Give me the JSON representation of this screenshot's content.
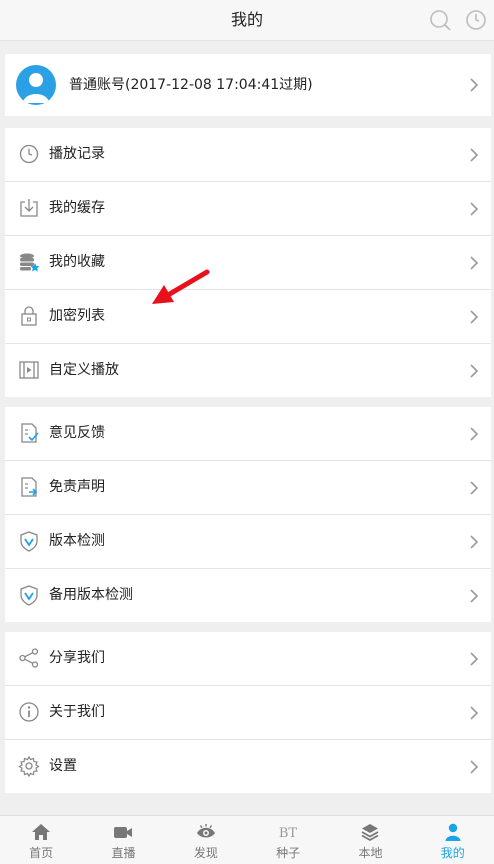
{
  "header": {
    "title": "我的"
  },
  "profile": {
    "account_text": "普通账号(2017-12-08 17:04:41过期)"
  },
  "groups": [
    {
      "items": [
        {
          "name": "play-history",
          "label": "播放记录",
          "icon": "clock-icon"
        },
        {
          "name": "my-cache",
          "label": "我的缓存",
          "icon": "download-icon"
        },
        {
          "name": "my-favorites",
          "label": "我的收藏",
          "icon": "database-star-icon"
        },
        {
          "name": "encrypted-list",
          "label": "加密列表",
          "icon": "lock-icon"
        },
        {
          "name": "custom-play",
          "label": "自定义播放",
          "icon": "film-play-icon"
        }
      ]
    },
    {
      "items": [
        {
          "name": "feedback",
          "label": "意见反馈",
          "icon": "document-check-icon"
        },
        {
          "name": "disclaimer",
          "label": "免责声明",
          "icon": "document-share-icon"
        },
        {
          "name": "version-check",
          "label": "版本检测",
          "icon": "shield-v-icon"
        },
        {
          "name": "backup-version-check",
          "label": "备用版本检测",
          "icon": "shield-v-icon"
        }
      ]
    },
    {
      "items": [
        {
          "name": "share-us",
          "label": "分享我们",
          "icon": "share-icon"
        },
        {
          "name": "about-us",
          "label": "关于我们",
          "icon": "info-icon"
        },
        {
          "name": "settings",
          "label": "设置",
          "icon": "gear-icon"
        }
      ]
    }
  ],
  "tabbar": {
    "active": "mine",
    "tabs": [
      {
        "name": "home",
        "label": "首页",
        "icon": "home-icon"
      },
      {
        "name": "live",
        "label": "直播",
        "icon": "video-camera-icon"
      },
      {
        "name": "discover",
        "label": "发现",
        "icon": "eye-icon"
      },
      {
        "name": "bt-seeds",
        "label": "种子",
        "icon": "bt-icon",
        "icon_text": "BT"
      },
      {
        "name": "local",
        "label": "本地",
        "icon": "layers-icon"
      },
      {
        "name": "mine",
        "label": "我的",
        "icon": "user-icon"
      }
    ]
  },
  "colors": {
    "accent": "#1aa3e8",
    "avatar": "#2aa0e6",
    "annotation_arrow": "#e8101a"
  }
}
